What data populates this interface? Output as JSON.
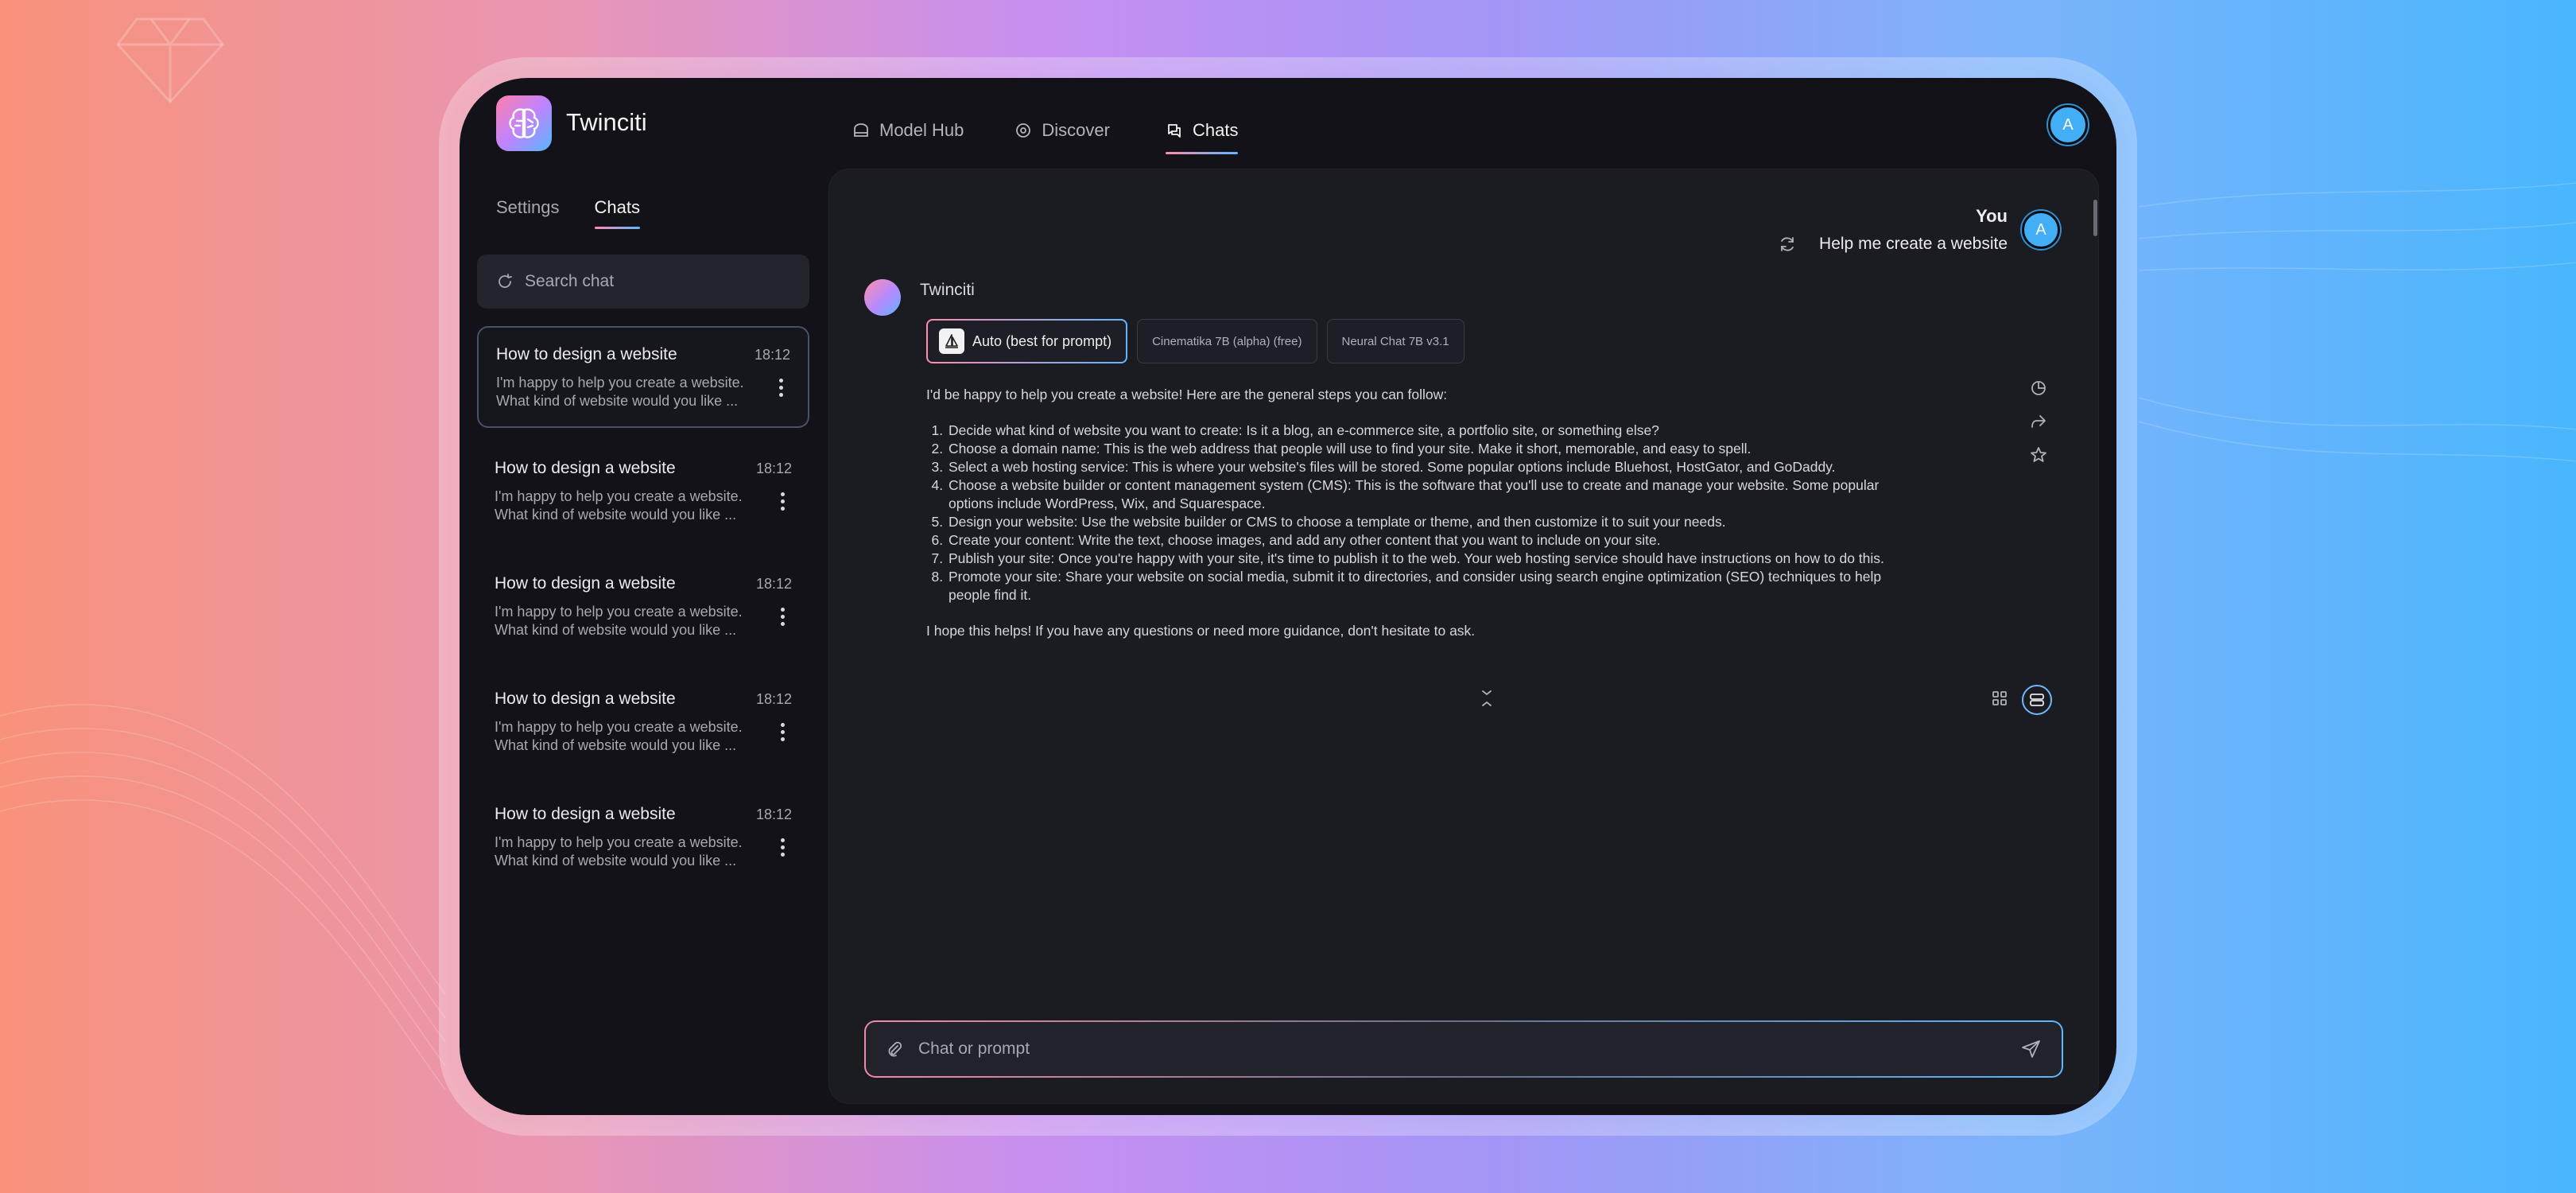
{
  "app": {
    "name": "Twinciti"
  },
  "nav": {
    "items": [
      {
        "label": "Model Hub",
        "icon": "model-hub-icon"
      },
      {
        "label": "Discover",
        "icon": "discover-icon"
      },
      {
        "label": "Chats",
        "icon": "chats-icon",
        "active": true
      }
    ]
  },
  "user": {
    "initial": "A"
  },
  "sidebar": {
    "tabs": [
      {
        "label": "Settings"
      },
      {
        "label": "Chats",
        "active": true
      }
    ],
    "search": {
      "placeholder": "Search chat"
    },
    "chats": [
      {
        "title": "How to design a website",
        "time": "18:12",
        "preview": "I'm happy to help you create a website. What kind of website would you like ..."
      },
      {
        "title": "How to design a website",
        "time": "18:12",
        "preview": "I'm happy to help you create a website. What kind of website would you like ..."
      },
      {
        "title": "How to design a website",
        "time": "18:12",
        "preview": "I'm happy to help you create a website. What kind of website would you like ..."
      },
      {
        "title": "How to design a website",
        "time": "18:12",
        "preview": "I'm happy to help you create a website. What kind of website would you like ..."
      },
      {
        "title": "How to design a website",
        "time": "18:12",
        "preview": "I'm happy to help you create a website. What kind of website would you like ..."
      }
    ]
  },
  "conversation": {
    "user_name": "You",
    "user_message": "Help me create a website",
    "bot_name": "Twinciti",
    "models": [
      {
        "label": "Auto (best for prompt)",
        "active": true
      },
      {
        "label": "Cinematika 7B (alpha) (free)"
      },
      {
        "label": "Neural Chat 7B v3.1"
      }
    ],
    "answer": {
      "intro": "I'd be happy to help you create a website! Here are the general steps you can follow:",
      "steps": [
        "Decide what kind of website you want to create: Is it a blog, an e-commerce site, a portfolio site, or something else?",
        "Choose a domain name: This is the web address that people will use to find your site. Make it short, memorable, and easy to spell.",
        "Select a web hosting service: This is where your website's files will be stored. Some popular options include Bluehost, HostGator, and GoDaddy.",
        "Choose a website builder or content management system (CMS): This is the software that you'll use to create and manage your website. Some popular options include WordPress, Wix, and Squarespace.",
        "Design your website: Use the website builder or CMS to choose a template or theme, and then customize it to suit your needs.",
        "Create your content: Write the text, choose images, and add any other content that you want to include on your site.",
        "Publish your site: Once you're happy with your site, it's time to publish it to the web. Your web hosting service should have instructions on how to do this.",
        "Promote your site: Share your website on social media, submit it to directories, and consider using search engine optimization (SEO) techniques to help people find it."
      ],
      "outro": "I hope this helps! If you have any questions or need more guidance, don't hesitate to ask."
    }
  },
  "composer": {
    "placeholder": "Chat or prompt"
  },
  "colors": {
    "accent_pink": "#ff8cae",
    "accent_blue": "#5fb6ff",
    "panel": "#1b1b22",
    "app_bg": "#121218"
  }
}
